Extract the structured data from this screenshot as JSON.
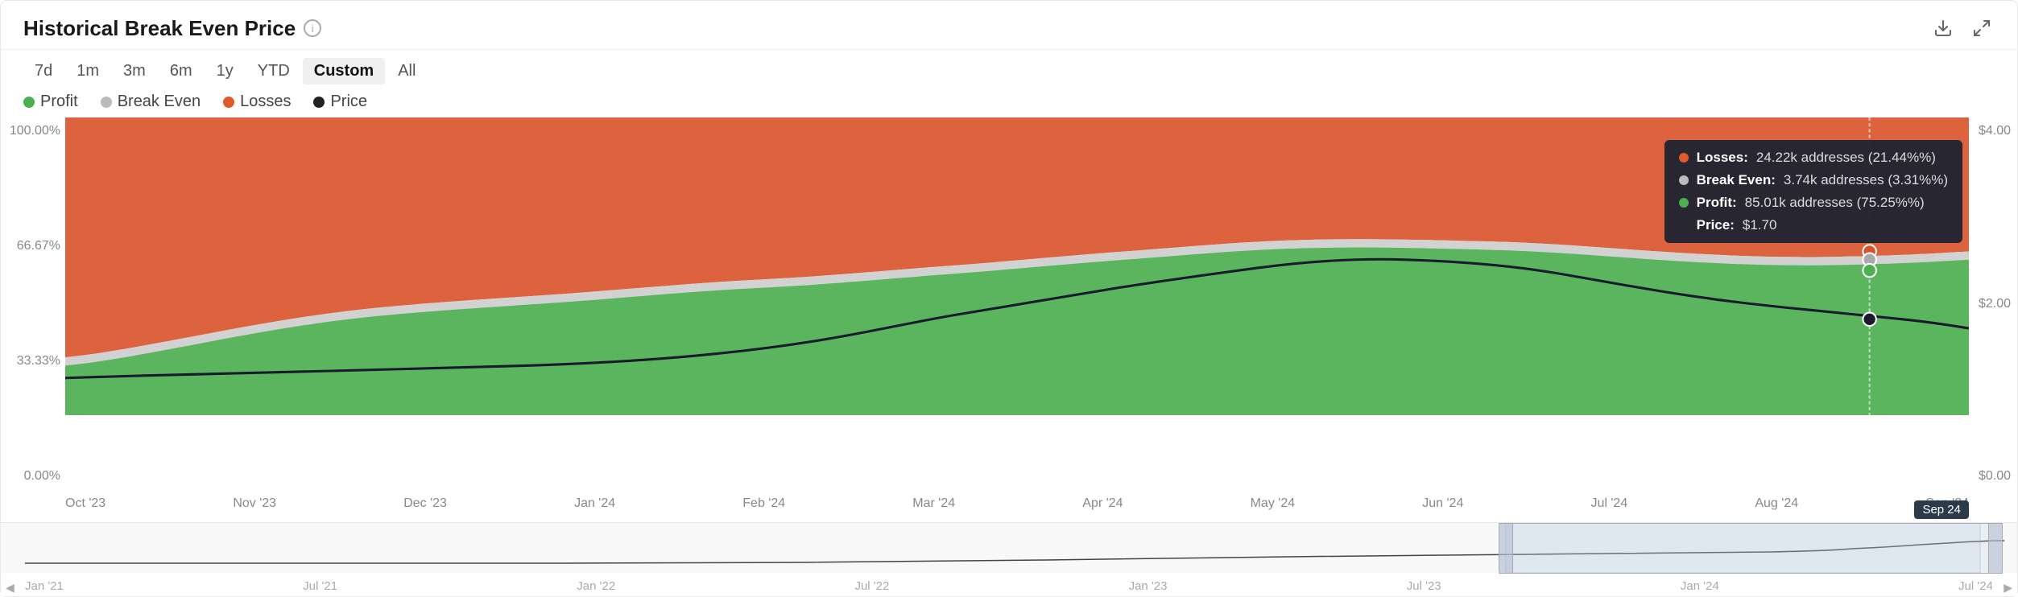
{
  "card": {
    "title": "Historical Break Even Price",
    "info_icon": "ℹ",
    "download_icon": "download",
    "expand_icon": "expand"
  },
  "time_filters": [
    {
      "label": "7d",
      "active": false
    },
    {
      "label": "1m",
      "active": false
    },
    {
      "label": "3m",
      "active": false
    },
    {
      "label": "6m",
      "active": false
    },
    {
      "label": "1y",
      "active": false
    },
    {
      "label": "YTD",
      "active": false
    },
    {
      "label": "Custom",
      "active": true
    },
    {
      "label": "All",
      "active": false
    }
  ],
  "legend": [
    {
      "label": "Profit",
      "color": "#4caf50"
    },
    {
      "label": "Break Even",
      "color": "#bbb"
    },
    {
      "label": "Losses",
      "color": "#e05a2b"
    },
    {
      "label": "Price",
      "color": "#222"
    }
  ],
  "y_axis_left": [
    "100.00%",
    "66.67%",
    "33.33%",
    "0.00%"
  ],
  "y_axis_right": [
    "$4.00",
    "$2.00",
    "$0.00"
  ],
  "x_axis_labels": [
    "Oct '23",
    "Nov '23",
    "Dec '23",
    "Jan '24",
    "Feb '24",
    "Mar '24",
    "Apr '24",
    "May '24",
    "Jun '24",
    "Jul '24",
    "Aug '24",
    "Sep '24"
  ],
  "tooltip": {
    "losses_label": "Losses:",
    "losses_value": "24.22k addresses (21.44%%)",
    "breakeven_label": "Break Even:",
    "breakeven_value": "3.74k addresses (3.31%%)",
    "profit_label": "Profit:",
    "profit_value": "85.01k addresses (75.25%%)",
    "price_label": "Price:",
    "price_value": "$1.70"
  },
  "date_badge": "Sep 24",
  "navigator_x_labels": [
    "Jan '21",
    "Jul '21",
    "Jan '22",
    "Jul '22",
    "Jan '23",
    "Jul '23",
    "Jan '24",
    "Jul '24"
  ],
  "colors": {
    "profit": "#4caf50",
    "break_even": "#c8c8c8",
    "losses": "#d9522a",
    "price_line": "#1a1a2e",
    "chart_bg": "#f9f9f9"
  }
}
